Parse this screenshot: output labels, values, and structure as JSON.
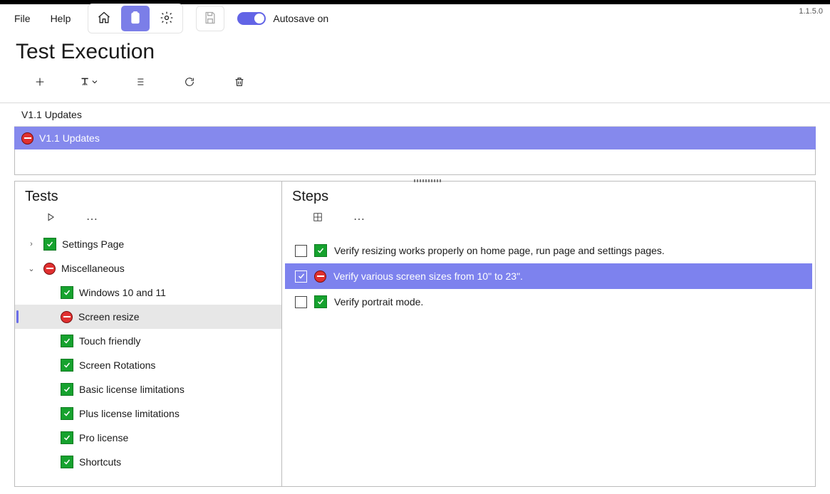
{
  "menu": {
    "file": "File",
    "help": "Help"
  },
  "autosave_label": "Autosave on",
  "version": "1.1.5.0",
  "page_title": "Test Execution",
  "breadcrumb": "V1.1 Updates",
  "run_title": "V1.1 Updates",
  "panels": {
    "tests_title": "Tests",
    "steps_title": "Steps"
  },
  "tests": {
    "items": [
      {
        "label": "Settings Page",
        "status": "pass",
        "expandable": true,
        "expanded": false,
        "child": false,
        "selected": false
      },
      {
        "label": "Miscellaneous",
        "status": "fail",
        "expandable": true,
        "expanded": true,
        "child": false,
        "selected": false
      },
      {
        "label": "Windows 10 and 11",
        "status": "pass",
        "expandable": false,
        "child": true,
        "selected": false
      },
      {
        "label": "Screen resize",
        "status": "fail",
        "expandable": false,
        "child": true,
        "selected": true
      },
      {
        "label": "Touch friendly",
        "status": "pass",
        "expandable": false,
        "child": true,
        "selected": false
      },
      {
        "label": "Screen Rotations",
        "status": "pass",
        "expandable": false,
        "child": true,
        "selected": false
      },
      {
        "label": "Basic license limitations",
        "status": "pass",
        "expandable": false,
        "child": true,
        "selected": false
      },
      {
        "label": "Plus license limitations",
        "status": "pass",
        "expandable": false,
        "child": true,
        "selected": false
      },
      {
        "label": "Pro license",
        "status": "pass",
        "expandable": false,
        "child": true,
        "selected": false
      },
      {
        "label": "Shortcuts",
        "status": "pass",
        "expandable": false,
        "child": true,
        "selected": false
      }
    ]
  },
  "steps": {
    "items": [
      {
        "label": "Verify resizing works properly on home page, run page and settings pages.",
        "status": "pass",
        "checked": false,
        "selected": false
      },
      {
        "label": "Verify various screen sizes from 10\" to 23\".",
        "status": "fail",
        "checked": true,
        "selected": true
      },
      {
        "label": "Verify portrait mode.",
        "status": "pass",
        "checked": false,
        "selected": false
      }
    ]
  }
}
